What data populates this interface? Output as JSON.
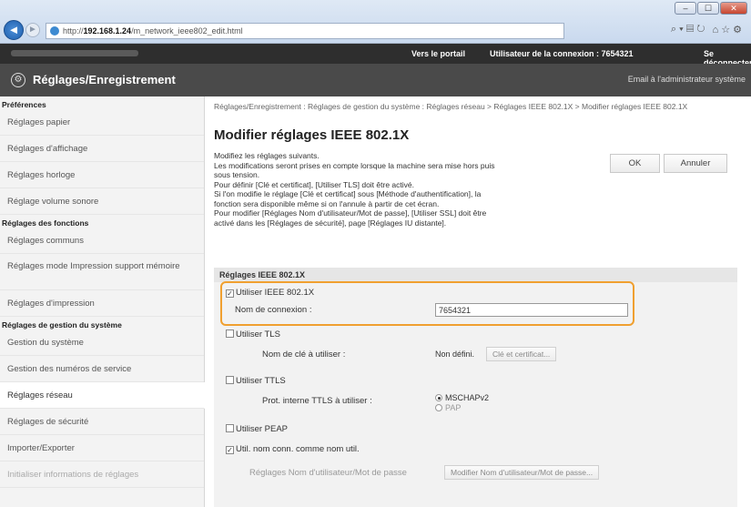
{
  "browser": {
    "url_prefix": "http://",
    "url_host": "192.168.1.24",
    "url_path": "/m_network_ieee802_edit.html",
    "search_glyph": "⌕ ▾ ▤ ↻",
    "icons_right": "⌂ ☆ ⚙",
    "win_min": "‒",
    "win_max": "☐",
    "win_close": "✕"
  },
  "topbar": {
    "portal": "Vers le portail",
    "user_label": "Utilisateur de la connexion :  7654321",
    "logout": "Se déconnecter"
  },
  "header": {
    "title": "Réglages/Enregistrement",
    "mail": "Email à l'administrateur système"
  },
  "sidebar": {
    "section_prefs": "Préférences",
    "prefs_items": [
      "Réglages papier",
      "Réglages d'affichage",
      "Réglages horloge",
      "Réglage volume sonore"
    ],
    "section_functions": "Réglages des fonctions",
    "functions_items": [
      "Réglages communs",
      "Réglages mode Impression support mémoire",
      "Réglages d'impression"
    ],
    "section_mgmt": "Réglages de gestion du système",
    "mgmt_items": [
      "Gestion du système",
      "Gestion des numéros de service",
      "Réglages réseau",
      "Réglages de sécurité",
      "Importer/Exporter",
      "Initialiser informations de réglages"
    ]
  },
  "main": {
    "breadcrumb": "Réglages/Enregistrement : Réglages de gestion du système : Réglages réseau > Réglages IEEE 802.1X > Modifier réglages IEEE 802.1X",
    "title": "Modifier réglages IEEE 802.1X",
    "desc_lines": [
      "Modifiez les réglages suivants.",
      "Les modifications seront prises en compte lorsque la machine sera mise hors puis",
      "sous tension.",
      "Pour définir [Clé et certificat], [Utiliser TLS] doit être activé.",
      "Si l'on modifie le réglage [Clé et certificat] sous [Méthode d'authentification], la",
      "fonction sera disponible même si on l'annule à partir de cet écran.",
      "Pour modifier [Réglages Nom d'utilisateur/Mot de passe], [Utiliser SSL] doit être",
      "activé dans les [Réglages de sécurité], page [Réglages IU distante]."
    ],
    "ok_label": "OK",
    "cancel_label": "Annuler",
    "section_title": "Réglages IEEE 802.1X",
    "use_ieee_label": "Utiliser IEEE 802.1X",
    "use_ieee_checked": true,
    "login_name_label": "Nom de connexion :",
    "login_name_value": "7654321",
    "use_tls_label": "Utiliser TLS",
    "key_name_label": "Nom de clé à utiliser :",
    "key_name_value": "Non défini.",
    "key_button": "Clé et certificat...",
    "use_ttls_label": "Utiliser TTLS",
    "ttls_protocol_label": "Prot. interne TTLS à utiliser :",
    "ttls_options": [
      "MSCHAPv2",
      "PAP"
    ],
    "use_peap_label": "Utiliser PEAP",
    "use_login_as_user_label": "Util. nom conn. comme nom util.",
    "use_login_as_user_checked": true,
    "userpass_label": "Réglages Nom d'utilisateur/Mot de passe",
    "userpass_button": "Modifier Nom d'utilisateur/Mot de passe..."
  },
  "colors": {
    "highlight": "#f0a030",
    "header_bg": "#4a4a4a",
    "topbar_bg": "#2e2e2e"
  }
}
